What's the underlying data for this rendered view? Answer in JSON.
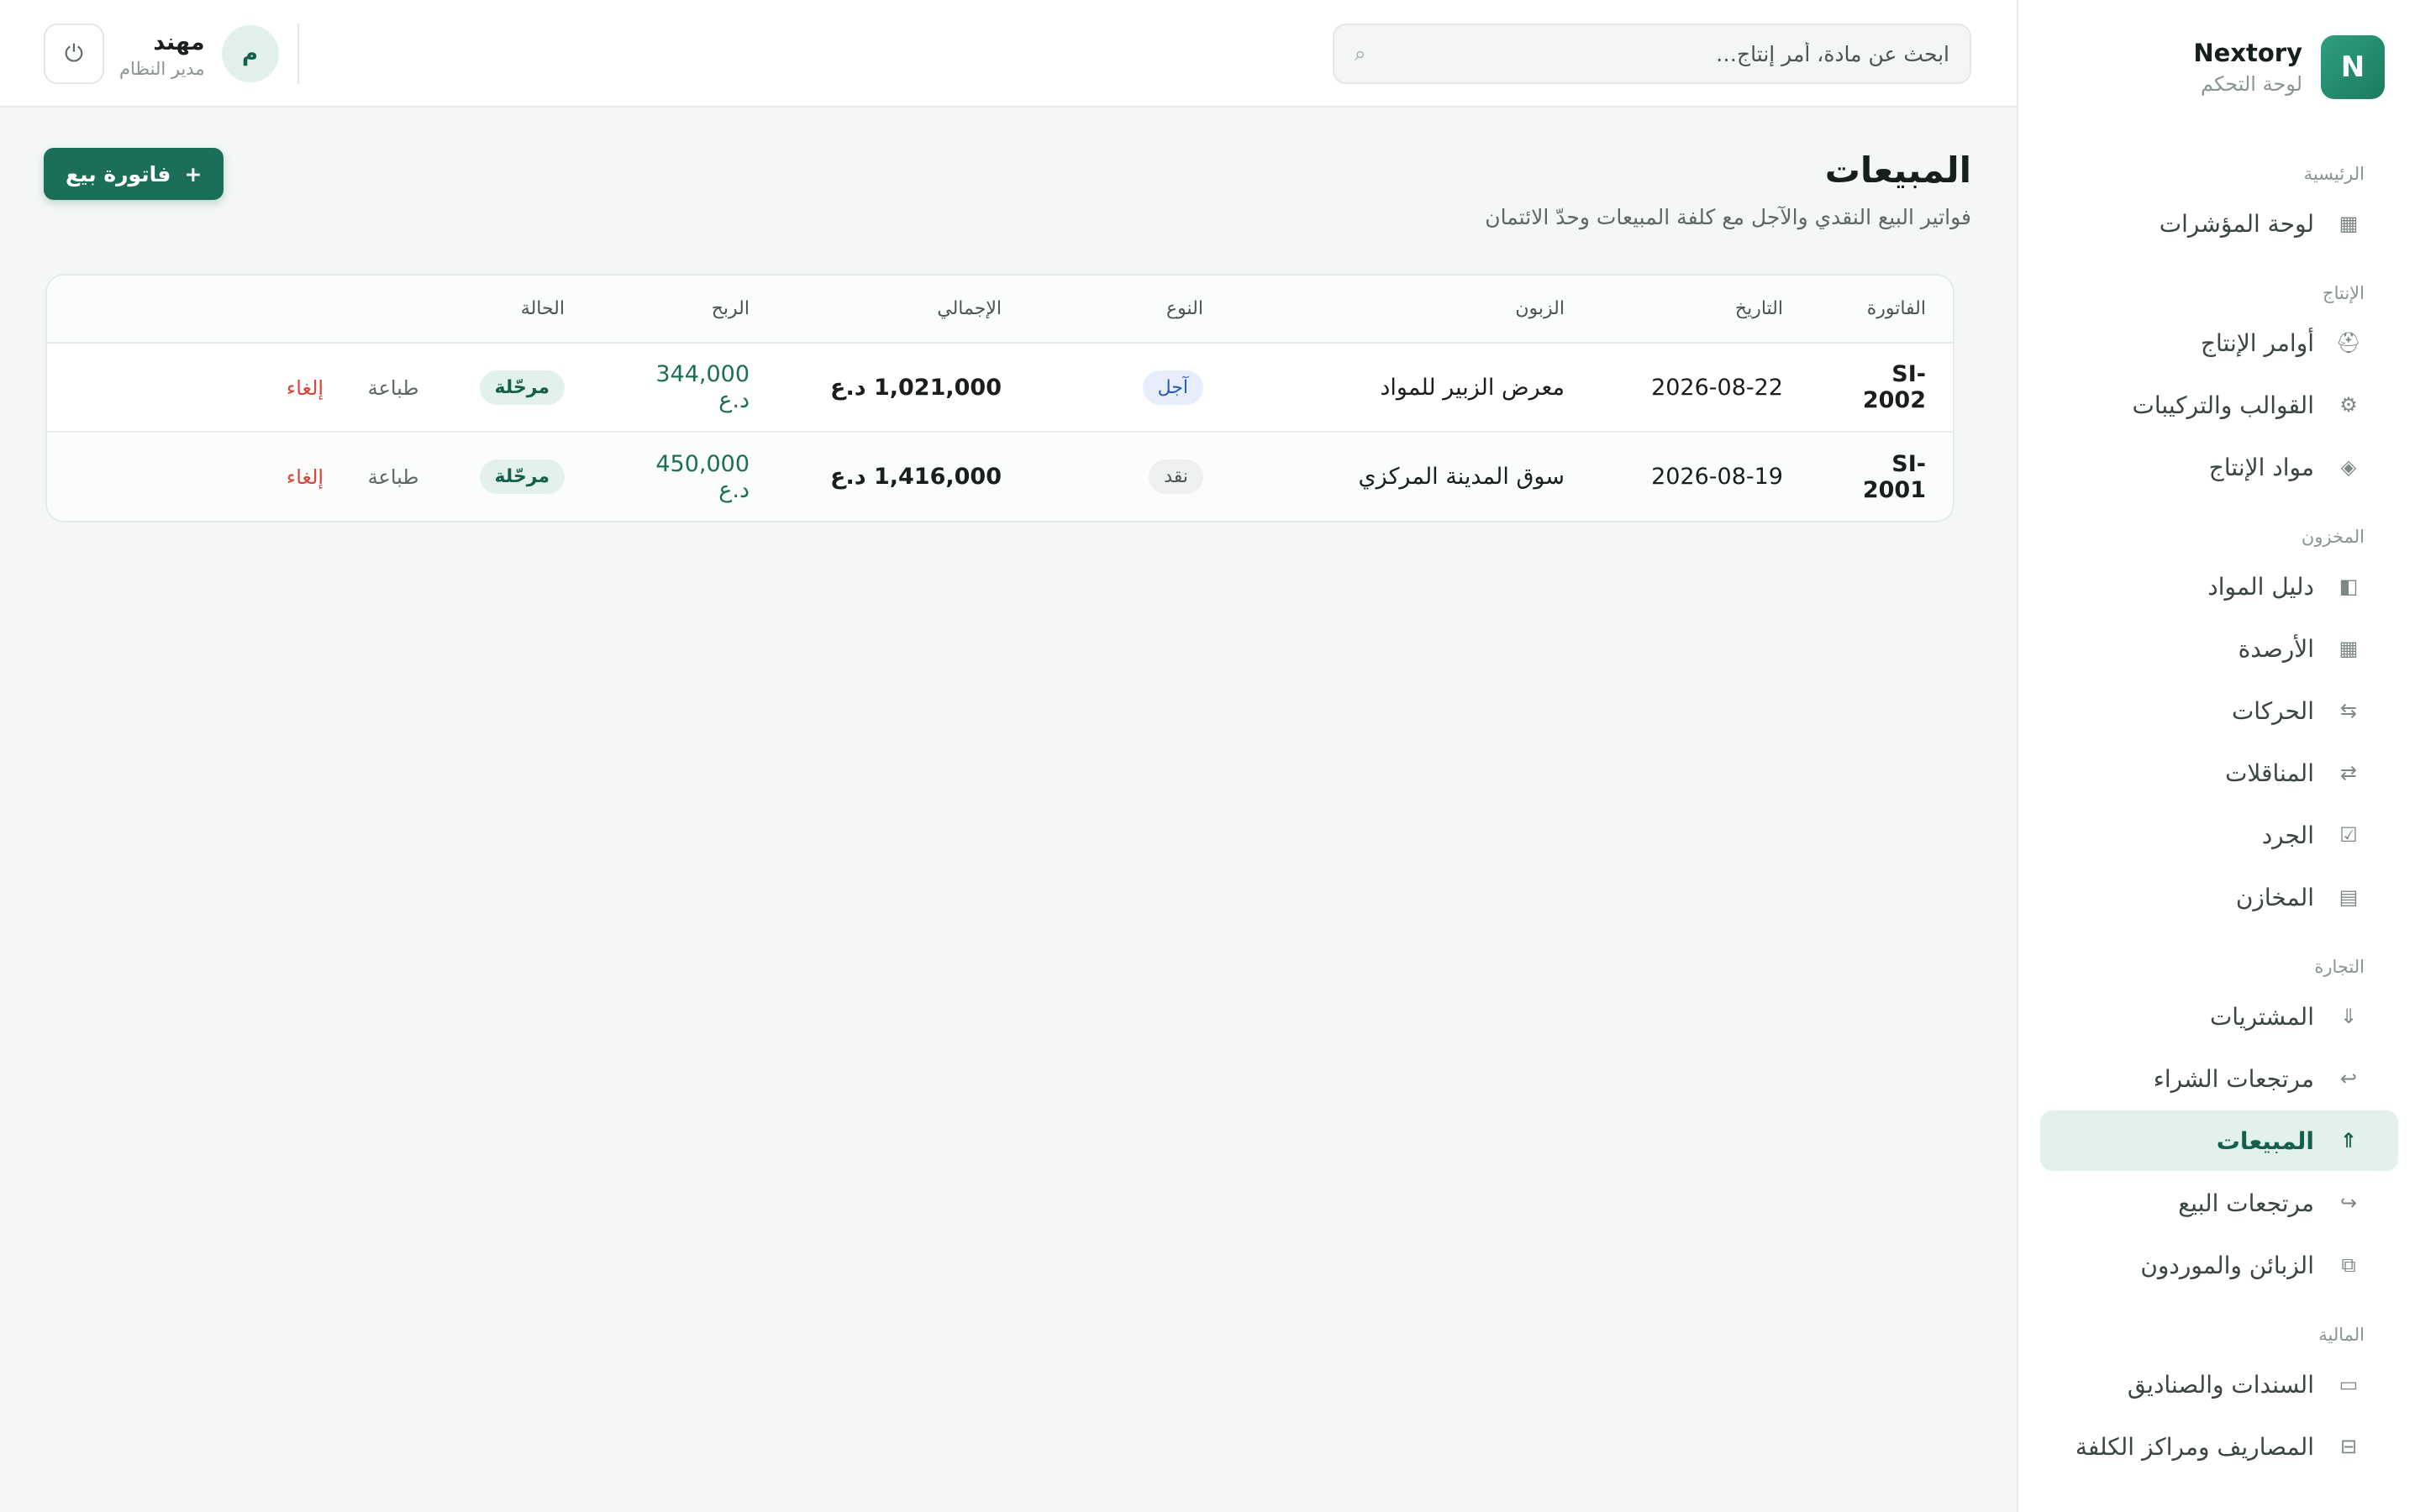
{
  "brand": {
    "logo_letter": "N",
    "name": "Nextory",
    "subtitle": "لوحة التحكم"
  },
  "search": {
    "placeholder": "ابحث عن مادة، أمر إنتاج…"
  },
  "user": {
    "initial": "م",
    "name": "مهند",
    "role": "مدير النظام"
  },
  "sidebar": {
    "sections": [
      {
        "heading": "الرئيسية",
        "items": [
          {
            "label": "لوحة المؤشرات",
            "icon": "grid-icon"
          }
        ]
      },
      {
        "heading": "الإنتاج",
        "items": [
          {
            "label": "أوامر الإنتاج",
            "icon": "worker-icon"
          },
          {
            "label": "القوالب والتركيبات",
            "icon": "gear-icon"
          },
          {
            "label": "مواد الإنتاج",
            "icon": "diamond-icon"
          }
        ]
      },
      {
        "heading": "المخزون",
        "items": [
          {
            "label": "دليل المواد",
            "icon": "book-icon"
          },
          {
            "label": "الأرصدة",
            "icon": "grid-icon"
          },
          {
            "label": "الحركات",
            "icon": "movements-icon"
          },
          {
            "label": "المناقلات",
            "icon": "transfer-icon"
          },
          {
            "label": "الجرد",
            "icon": "checkbox-icon"
          },
          {
            "label": "المخازن",
            "icon": "warehouse-icon"
          }
        ]
      },
      {
        "heading": "التجارة",
        "items": [
          {
            "label": "المشتريات",
            "icon": "arrow-down-icon"
          },
          {
            "label": "مرتجعات الشراء",
            "icon": "return-icon"
          },
          {
            "label": "المبيعات",
            "icon": "arrow-up-icon",
            "active": true
          },
          {
            "label": "مرتجعات البيع",
            "icon": "return-alt-icon"
          },
          {
            "label": "الزبائن والموردون",
            "icon": "contacts-icon"
          }
        ]
      },
      {
        "heading": "المالية",
        "items": [
          {
            "label": "السندات والصناديق",
            "icon": "cash-icon"
          },
          {
            "label": "المصاريف ومراكز الكلفة",
            "icon": "expense-icon"
          }
        ]
      }
    ]
  },
  "page": {
    "title": "المبيعات",
    "subtitle": "فواتير البيع النقدي والآجل مع كلفة المبيعات وحدّ الائتمان",
    "new_button": "فاتورة بيع"
  },
  "table": {
    "headers": [
      "الفاتورة",
      "التاريخ",
      "الزبون",
      "النوع",
      "الإجمالي",
      "الربح",
      "الحالة",
      ""
    ],
    "rows": [
      {
        "invoice": "SI-2002",
        "date": "2026-08-22",
        "customer": "معرض الزبير للمواد",
        "type": "آجل",
        "type_kind": "credit",
        "total": "1,021,000 د.ع",
        "profit": "344,000 د.ع",
        "status": "مرحّلة",
        "print": "طباعة",
        "cancel": "إلغاء"
      },
      {
        "invoice": "SI-2001",
        "date": "2026-08-19",
        "customer": "سوق المدينة المركزي",
        "type": "نقد",
        "type_kind": "cash",
        "total": "1,416,000 د.ع",
        "profit": "450,000 د.ع",
        "status": "مرحّلة",
        "print": "طباعة",
        "cancel": "إلغاء"
      }
    ]
  },
  "colors": {
    "accent": "#1b6e57",
    "active_bg": "#e3f1ec",
    "danger": "#d4473b",
    "credit_badge": "#2a56b8"
  }
}
